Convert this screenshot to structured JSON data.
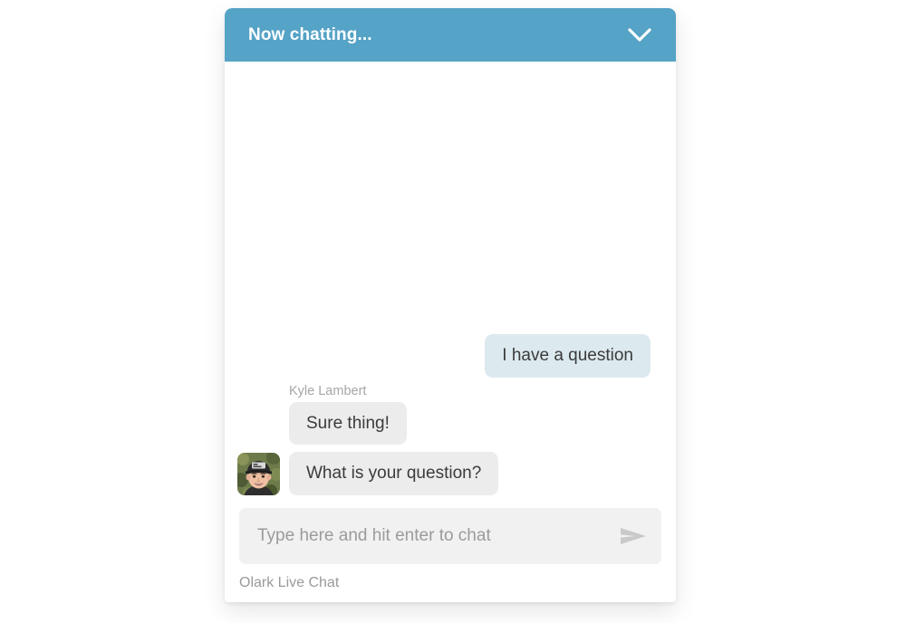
{
  "widget": {
    "header": {
      "title": "Now chatting...",
      "minimize_icon": "chevron-down-icon",
      "background_color": "#55a3c6",
      "title_color": "#ffffff"
    },
    "transcript": {
      "messages": [
        {
          "id": "m1",
          "role": "visitor",
          "text": "I have a question",
          "show_name": false,
          "show_avatar": false,
          "bubble_color": "#dce9ef"
        },
        {
          "id": "m2",
          "role": "operator",
          "author": "Kyle Lambert",
          "text": "Sure thing!",
          "show_name": true,
          "show_avatar": false,
          "bubble_color": "#ececec"
        },
        {
          "id": "m3",
          "role": "operator",
          "author": "Kyle Lambert",
          "text": "What is your question?",
          "show_name": false,
          "show_avatar": true,
          "avatar_alt": "Kyle Lambert avatar",
          "bubble_color": "#ececec"
        }
      ]
    },
    "composer": {
      "input_value": "",
      "placeholder": "Type here and hit enter to chat",
      "send_icon": "send-paper-plane-icon",
      "field_background": "#f1f1f1"
    },
    "footer": {
      "label": "Olark Live Chat"
    }
  },
  "colors": {
    "accent": "#55a3c6",
    "visitor_bubble": "#dce9ef",
    "operator_bubble": "#ececec",
    "text_dark": "#3b3b3b",
    "text_muted": "#9a9a9a",
    "page_background": "#ffffff"
  }
}
